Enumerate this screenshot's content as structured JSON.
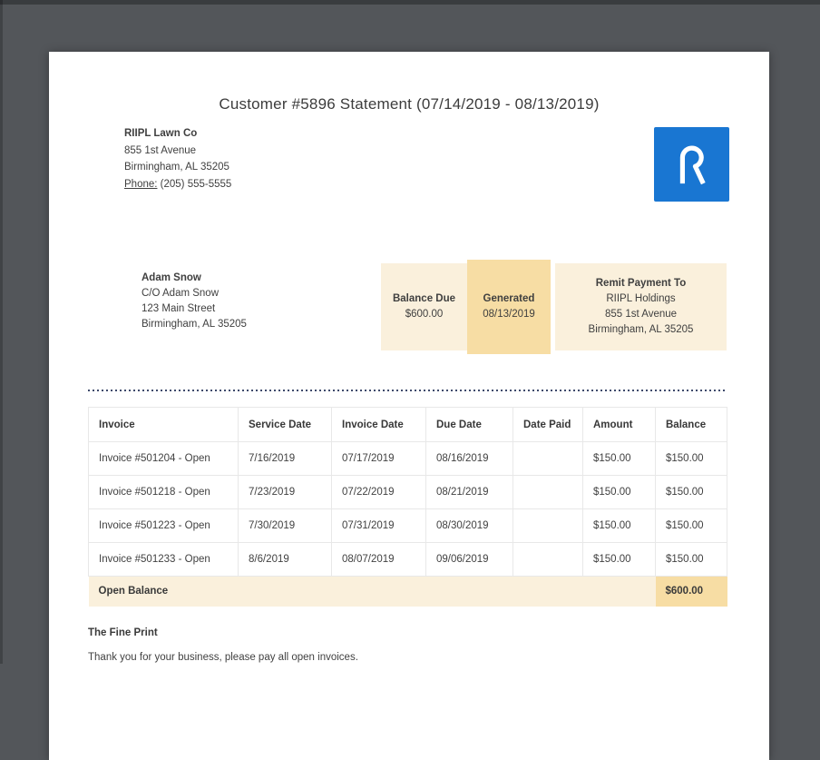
{
  "doc": {
    "title": "Customer #5896 Statement (07/14/2019 - 08/13/2019)"
  },
  "company": {
    "name": "RIIPL Lawn Co",
    "address_line1": "855 1st Avenue",
    "address_line2": "Birmingham, AL 35205",
    "phone_label": "Phone:",
    "phone": "(205) 555-5555"
  },
  "logo": {
    "letter": "R",
    "color": "#1976D2"
  },
  "customer": {
    "name": "Adam Snow",
    "care_of": "C/O Adam Snow",
    "address_line1": "123 Main Street",
    "address_line2": "Birmingham, AL 35205"
  },
  "summary": {
    "balance_due": {
      "label": "Balance Due",
      "value": "$600.00"
    },
    "generated": {
      "label": "Generated",
      "value": "08/13/2019"
    },
    "remit": {
      "label": "Remit Payment To",
      "name": "RIIPL Holdings",
      "address_line1": "855 1st Avenue",
      "address_line2": "Birmingham, AL 35205"
    }
  },
  "table": {
    "headers": [
      "Invoice",
      "Service Date",
      "Invoice Date",
      "Due Date",
      "Date Paid",
      "Amount",
      "Balance"
    ],
    "rows": [
      [
        "Invoice #501204 - Open",
        "7/16/2019",
        "07/17/2019",
        "08/16/2019",
        "",
        "$150.00",
        "$150.00"
      ],
      [
        "Invoice #501218 - Open",
        "7/23/2019",
        "07/22/2019",
        "08/21/2019",
        "",
        "$150.00",
        "$150.00"
      ],
      [
        "Invoice #501223 - Open",
        "7/30/2019",
        "07/31/2019",
        "08/30/2019",
        "",
        "$150.00",
        "$150.00"
      ],
      [
        "Invoice #501233 - Open",
        "8/6/2019",
        "08/07/2019",
        "09/06/2019",
        "",
        "$150.00",
        "$150.00"
      ]
    ],
    "footer": {
      "label": "Open Balance",
      "value": "$600.00"
    }
  },
  "fine_print": {
    "heading": "The Fine Print",
    "text": "Thank you for your business, please pay all open invoices."
  },
  "colors": {
    "brand_blue": "#1976D2",
    "highlight_light": "#FAF0DC",
    "highlight_dark": "#F7DDA4",
    "divider_navy": "#3E4A6B",
    "viewer_background": "#53565A"
  }
}
